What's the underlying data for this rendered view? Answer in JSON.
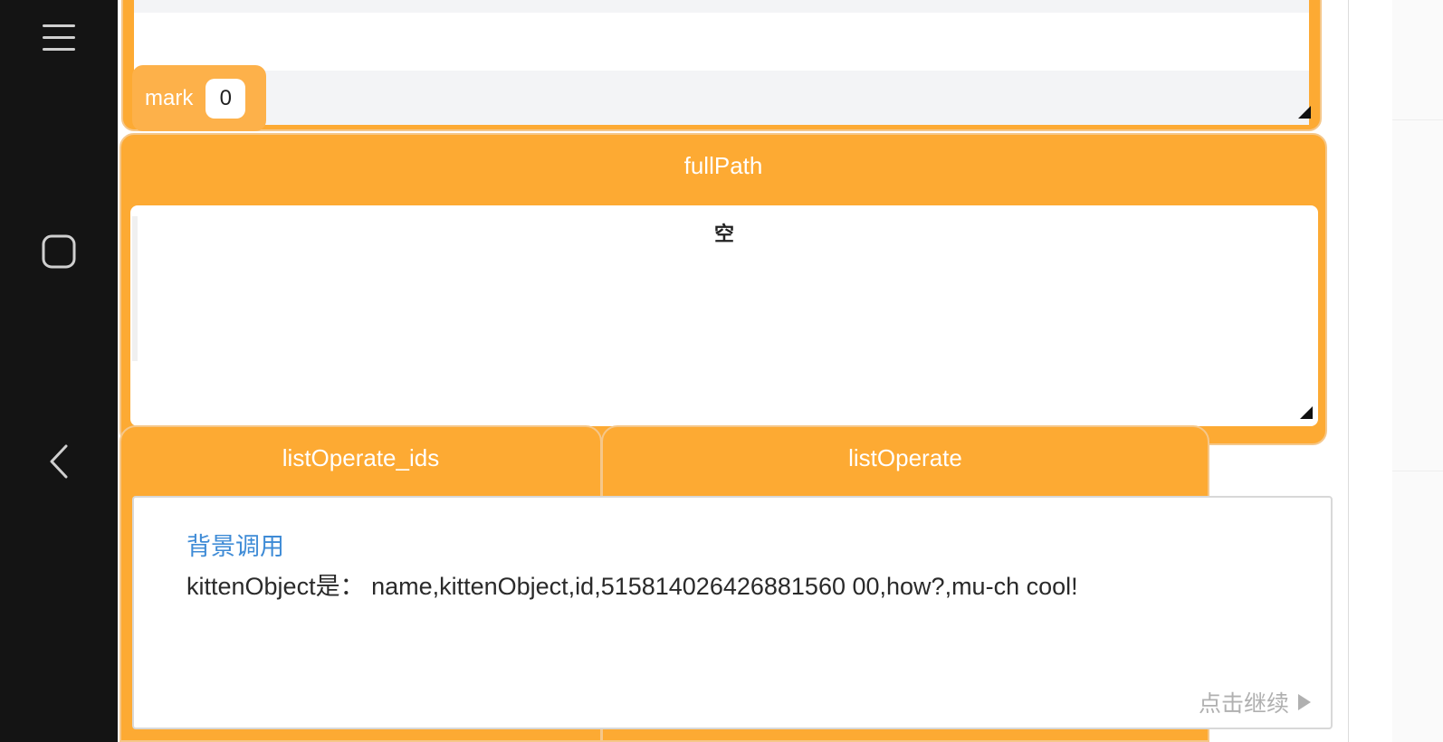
{
  "top_panel": {
    "mark_label": "mark",
    "mark_value": "0"
  },
  "full_path": {
    "title": "fullPath",
    "value": "空"
  },
  "tabs": [
    {
      "label": "listOperate_ids"
    },
    {
      "label": "listOperate"
    }
  ],
  "dialog": {
    "title": "背景调用",
    "text": "kittenObject是：  name,kittenObject,id,515814026426881560 00,how?,mu-ch cool!",
    "continue_label": "点击继续"
  },
  "icons": {
    "menu": "menu-icon",
    "home": "home-icon",
    "back": "back-icon",
    "continue": "play-arrow-icon"
  },
  "colors": {
    "accent_orange": "#fdaa33",
    "link_blue": "#3e8bd6",
    "navbar": "#141414"
  }
}
